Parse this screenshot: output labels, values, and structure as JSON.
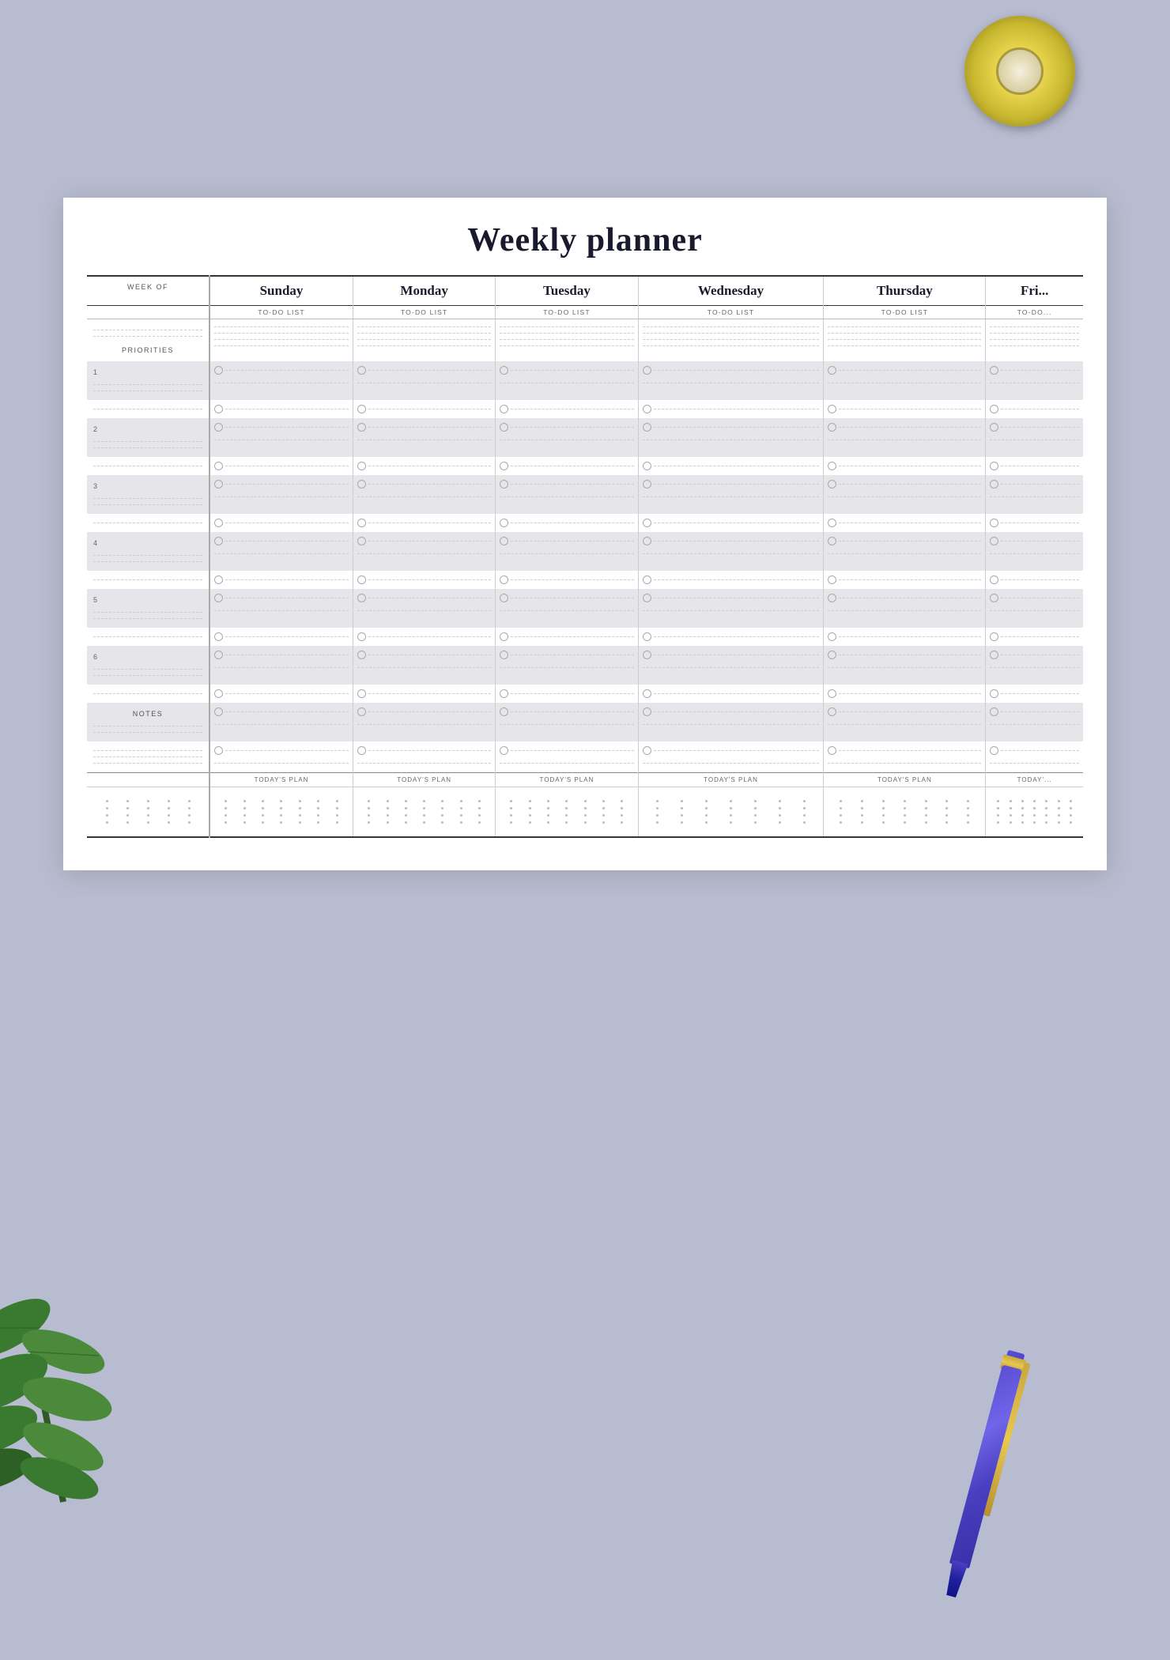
{
  "title": "Weekly planner",
  "header": {
    "week_of_label": "WEEK OF",
    "days": [
      "Sunday",
      "Monday",
      "Tuesday",
      "Wednesday",
      "Thursday",
      "Fri..."
    ],
    "todo_label": "TO-DO LIST"
  },
  "left": {
    "priorities_label": "PRIORITIES",
    "notes_label": "NOTES",
    "priority_numbers": [
      "1",
      "2",
      "3",
      "4",
      "5",
      "6"
    ]
  },
  "todays_plan_label": "TODAY'S PLAN",
  "colors": {
    "background": "#b8bcd0",
    "paper": "#ffffff",
    "shaded_row": "#e5e5ea",
    "accent": "#1a1a2e"
  }
}
